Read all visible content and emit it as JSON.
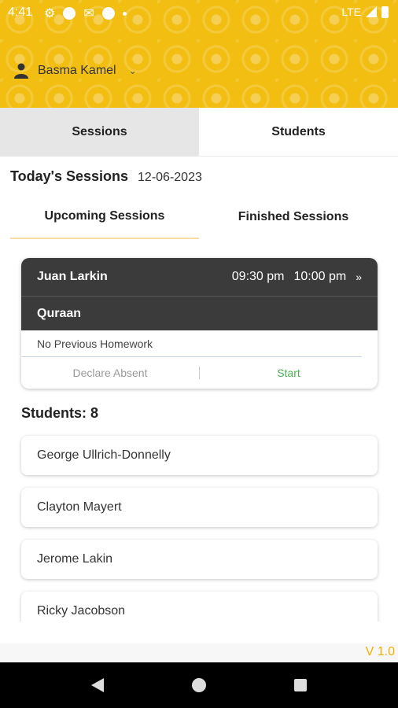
{
  "status_bar": {
    "time": "4:41",
    "network": "LTE",
    "icons": [
      "gear-icon",
      "circle-icon",
      "mail-icon",
      "circle-icon",
      "dot-icon",
      "signal-icon",
      "battery-icon"
    ]
  },
  "header": {
    "user_name": "Basma Kamel",
    "brand_color": "#f2be12"
  },
  "tabs": [
    {
      "label": "Sessions",
      "active": true
    },
    {
      "label": "Students",
      "active": false
    }
  ],
  "today": {
    "label": "Today's Sessions",
    "date": "12-06-2023"
  },
  "subtabs": [
    {
      "label": "Upcoming Sessions",
      "active": true
    },
    {
      "label": "Finished Sessions",
      "active": false
    }
  ],
  "session": {
    "student": "Juan Larkin",
    "start_time": "09:30 pm",
    "end_time": "10:00 pm",
    "subject": "Quraan",
    "homework": "No Previous Homework",
    "absent_label": "Declare Absent",
    "start_label": "Start"
  },
  "students": {
    "title": "Students: 8",
    "list": [
      "George Ullrich-Donnelly",
      "Clayton Mayert",
      "Jerome Lakin",
      "Ricky Jacobson"
    ]
  },
  "version": "V 1.0"
}
